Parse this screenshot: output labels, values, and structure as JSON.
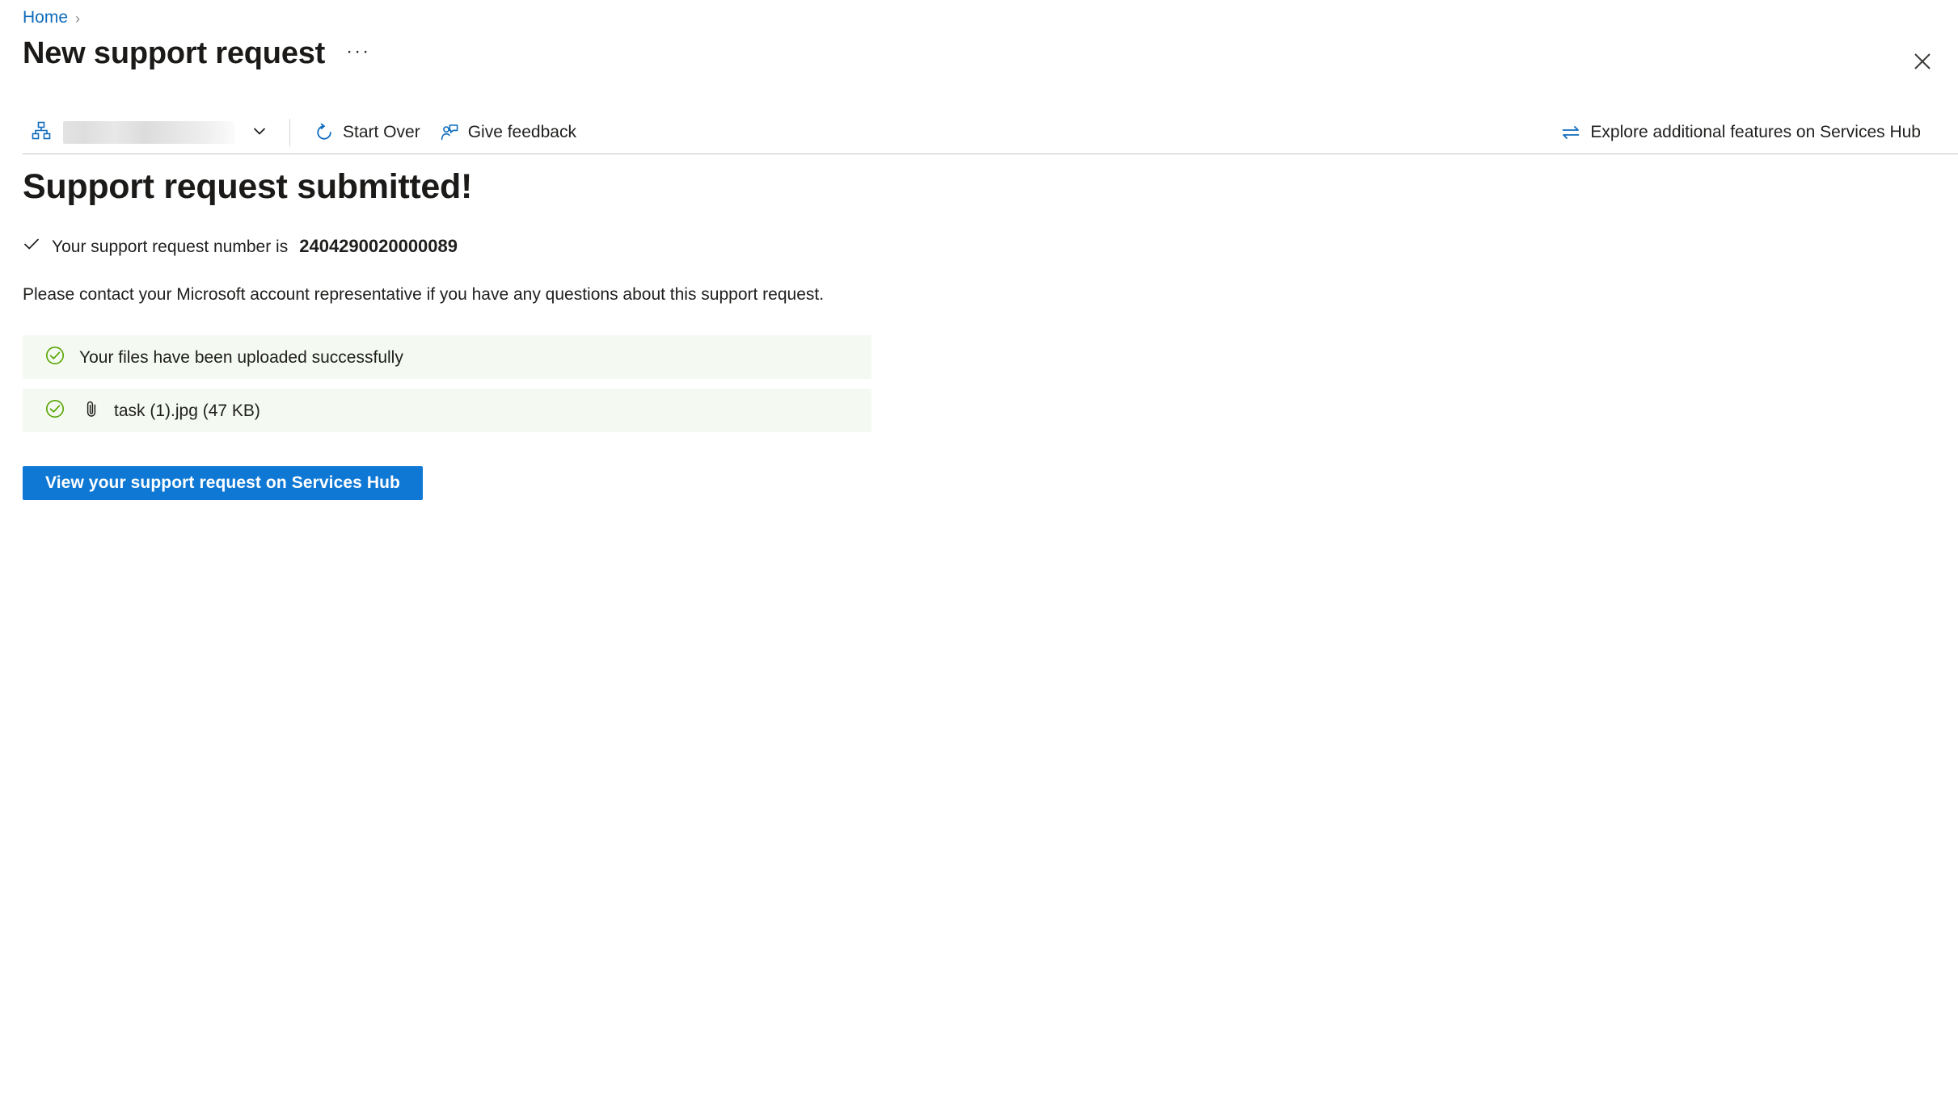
{
  "breadcrumb": {
    "home_label": "Home",
    "separator": "›"
  },
  "header": {
    "title": "New support request",
    "more_menu_label": "···",
    "close_icon": "close-icon"
  },
  "commandbar": {
    "scope": {
      "icon": "org-hierarchy-icon",
      "value": "",
      "chevron_icon": "chevron-down-icon"
    },
    "items": [
      {
        "label": "Start Over",
        "icon": "restart-circular-arrow-icon"
      },
      {
        "label": "Give feedback",
        "icon": "person-feedback-icon"
      }
    ],
    "right_item": {
      "label": "Explore additional features on Services Hub",
      "icon": "swap-arrows-icon"
    }
  },
  "main": {
    "heading": "Support request submitted!",
    "request_number_prefix": "Your support request number is",
    "request_number": "2404290020000089",
    "request_number_check_icon": "checkmark-icon",
    "contact_note": "Please contact your Microsoft account representative if you have any questions about this support request.",
    "status_items": [
      {
        "text": "Your files have been uploaded successfully",
        "icon": "circle-check-icon",
        "has_attachment_icon": false
      },
      {
        "text": "task (1).jpg (47 KB)",
        "icon": "circle-check-icon",
        "has_attachment_icon": true,
        "attachment_icon": "paperclip-icon"
      }
    ],
    "primary_button_label": "View your support request on Services Hub"
  },
  "colors": {
    "accent": "#0f78d4",
    "link": "#0f6cbd",
    "success_green": "#57a300",
    "success_bg": "#f4faf2",
    "text": "#201f1e"
  }
}
